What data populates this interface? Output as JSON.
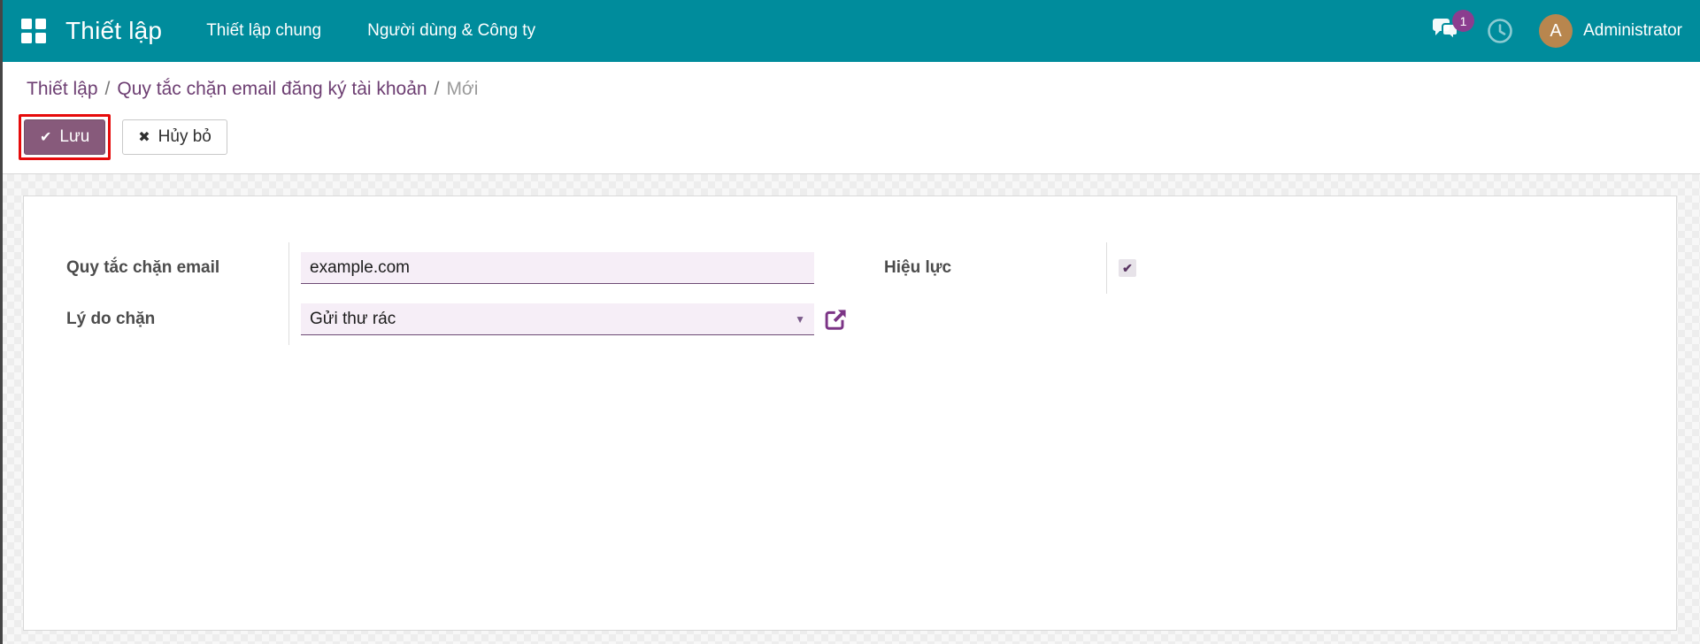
{
  "navbar": {
    "brand": "Thiết lập",
    "menu_items": [
      {
        "label": "Thiết lập chung"
      },
      {
        "label": "Người dùng & Công ty"
      }
    ],
    "message_badge_count": "1",
    "user": {
      "name": "Administrator",
      "avatar_initial": "A"
    }
  },
  "breadcrumb": {
    "separator": "/",
    "links": [
      {
        "label": "Thiết lập"
      },
      {
        "label": "Quy tắc chặn email đăng ký tài khoản"
      }
    ],
    "current": "Mới"
  },
  "toolbar": {
    "save_label": "Lưu",
    "cancel_label": "Hủy bỏ"
  },
  "form": {
    "email_rule": {
      "label": "Quy tắc chặn email",
      "value": "example.com"
    },
    "block_reason": {
      "label": "Lý do chặn",
      "value": "Gửi thư rác"
    },
    "active": {
      "label": "Hiệu lực",
      "checked": "true"
    }
  },
  "icons": {
    "check": "✔",
    "times": "✖",
    "caret_down": "▼",
    "checkbox_check": "✔"
  },
  "colors": {
    "navbar_teal": "#008c9c",
    "primary_purple": "#875a7b",
    "highlight_red": "#e60b0b",
    "breadcrumb_link": "#6d3e72",
    "field_bg": "#f6eef7",
    "field_border": "#6d4a74",
    "icon_purple": "#7c3586",
    "avatar_bg": "#b8864e",
    "badge_bg": "#8b3d8f"
  }
}
